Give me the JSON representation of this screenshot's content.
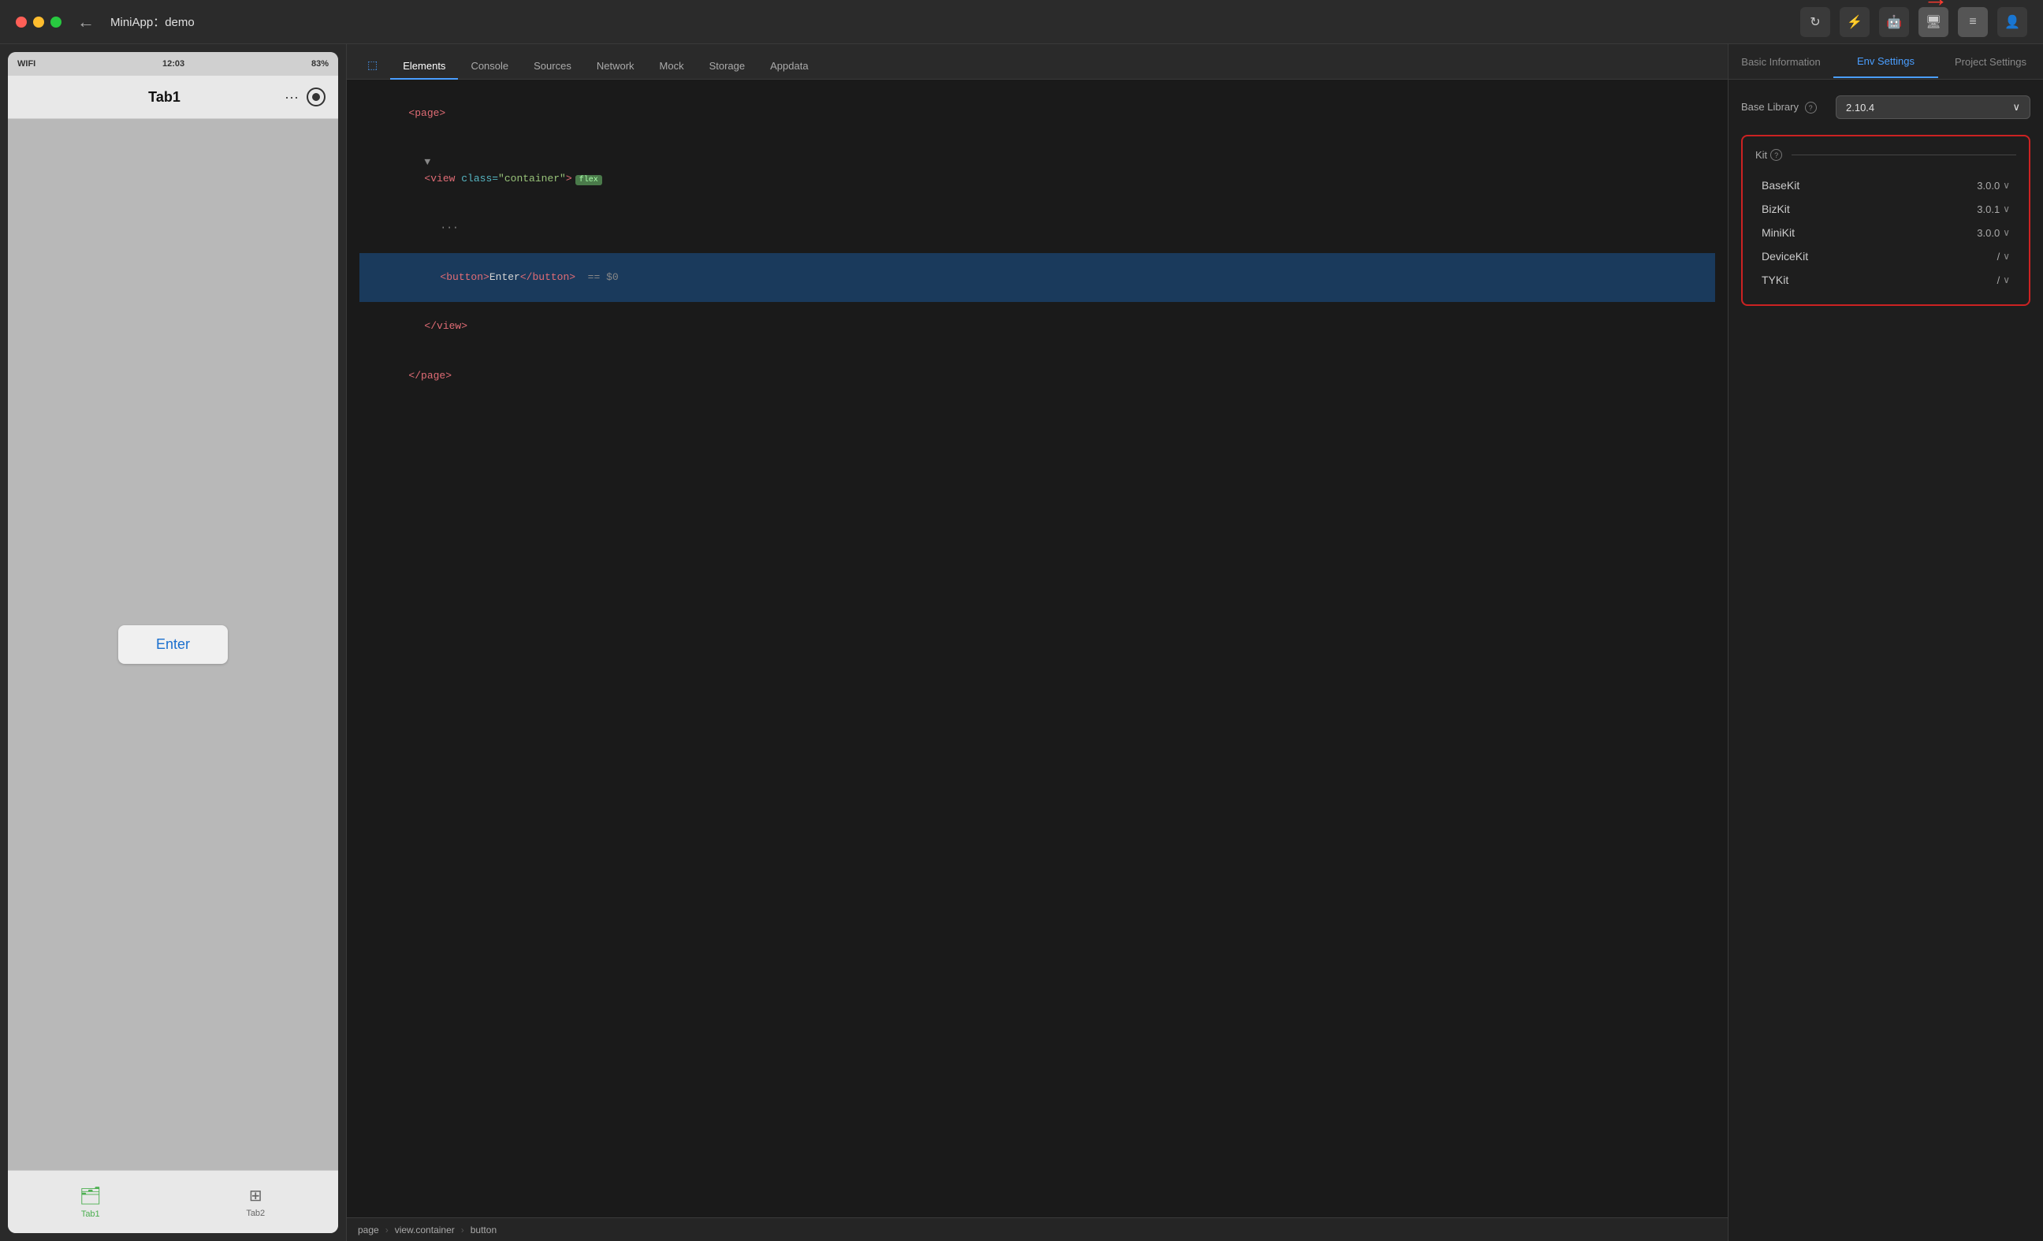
{
  "titleBar": {
    "appName": "MiniApp：demo",
    "backLabel": "←",
    "actions": {
      "refreshIcon": "↺",
      "debugIcon": "⚙",
      "moreIcon": "≡",
      "profileIcon": "👤"
    }
  },
  "phoneSim": {
    "statusBar": {
      "wifi": "WIFI",
      "time": "12:03",
      "battery": "83%"
    },
    "navBar": {
      "title": "Tab1",
      "dotsLabel": "···"
    },
    "body": {
      "enterButton": "Enter"
    },
    "tabBar": {
      "tab1Label": "Tab1",
      "tab2Label": "Tab2"
    }
  },
  "devtools": {
    "tabs": [
      {
        "label": "Elements",
        "active": true
      },
      {
        "label": "Console",
        "active": false
      },
      {
        "label": "Sources",
        "active": false
      },
      {
        "label": "Network",
        "active": false
      },
      {
        "label": "Mock",
        "active": false
      },
      {
        "label": "Storage",
        "active": false
      },
      {
        "label": "Appdata",
        "active": false
      }
    ],
    "codeLines": [
      {
        "text": "<page>",
        "indent": 0
      },
      {
        "text": "<view class=\"container\">",
        "indent": 1,
        "hasFlex": true
      },
      {
        "text": "···",
        "indent": 2,
        "isComment": true
      },
      {
        "text": "<button>Enter</button>  == $0",
        "indent": 2,
        "isSelected": true
      },
      {
        "text": "</view>",
        "indent": 1
      },
      {
        "text": "</page>",
        "indent": 0
      }
    ],
    "breadcrumb": [
      "page",
      "view.container",
      "button"
    ]
  },
  "rightPanel": {
    "tabs": [
      {
        "label": "Basic Information"
      },
      {
        "label": "Env Settings",
        "active": true
      },
      {
        "label": "Project Settings"
      }
    ],
    "baseLibrary": {
      "label": "Base Library",
      "value": "2.10.4"
    },
    "kits": {
      "sectionLabel": "Kit",
      "items": [
        {
          "name": "BaseKit",
          "version": "3.0.0"
        },
        {
          "name": "BizKit",
          "version": "3.0.1"
        },
        {
          "name": "MiniKit",
          "version": "3.0.0"
        },
        {
          "name": "DeviceKit",
          "version": "/"
        },
        {
          "name": "TYKit",
          "version": "/"
        }
      ]
    }
  }
}
